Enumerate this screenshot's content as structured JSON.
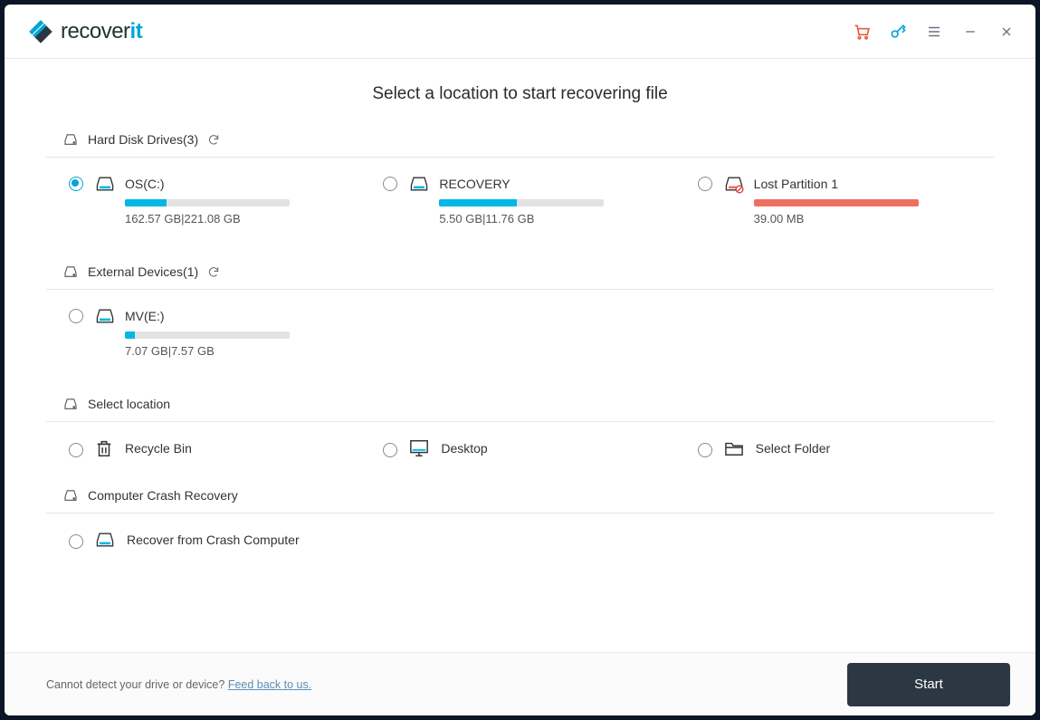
{
  "app": {
    "name_left": "recover",
    "name_accent": "it"
  },
  "page": {
    "title": "Select a location to start recovering file"
  },
  "sections": {
    "hdd": {
      "title": "Hard Disk Drives(3)",
      "items": [
        {
          "name": "OS(C:)",
          "used": "162.57  GB",
          "total": "221.08  GB",
          "pct": 25,
          "selected": true,
          "red": false,
          "warn": false
        },
        {
          "name": "RECOVERY",
          "used": "5.50  GB",
          "total": "11.76  GB",
          "pct": 47,
          "selected": false,
          "red": false,
          "warn": false
        },
        {
          "name": "Lost Partition 1",
          "used": "39.00  MB",
          "total": "",
          "pct": 100,
          "selected": false,
          "red": true,
          "warn": true
        }
      ]
    },
    "ext": {
      "title": "External Devices(1)",
      "items": [
        {
          "name": "MV(E:)",
          "used": "7.07  GB",
          "total": "7.57  GB",
          "pct": 6,
          "selected": false,
          "red": false,
          "warn": false
        }
      ]
    },
    "loc": {
      "title": "Select location",
      "items": [
        {
          "name": "Recycle Bin",
          "icon": "recycle-bin"
        },
        {
          "name": "Desktop",
          "icon": "desktop"
        },
        {
          "name": "Select Folder",
          "icon": "folder"
        }
      ]
    },
    "crash": {
      "title": "Computer Crash Recovery",
      "items": [
        {
          "name": "Recover from Crash Computer",
          "icon": "drive"
        }
      ]
    }
  },
  "footer": {
    "text": "Cannot detect your drive or device? ",
    "link": "Feed back to us.",
    "start": "Start"
  }
}
